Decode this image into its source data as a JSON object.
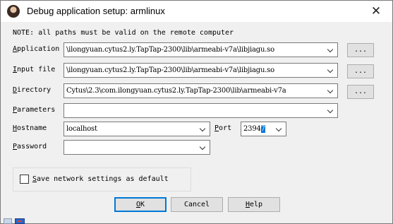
{
  "window": {
    "title": "Debug application setup: armlinux",
    "close_glyph": "✕"
  },
  "note": "NOTE: all paths must be valid on the remote computer",
  "fields": {
    "application": {
      "label": "Application",
      "value": "\\ilongyuan.cytus2.ly.TapTap-2300\\lib\\armeabi-v7a\\libjiagu.so",
      "browse_label": "..."
    },
    "input_file": {
      "label": "Input file",
      "value": "\\ilongyuan.cytus2.ly.TapTap-2300\\lib\\armeabi-v7a\\libjiagu.so",
      "browse_label": "..."
    },
    "directory": {
      "label": "Directory",
      "value": "Cytus\\2.3\\com.ilongyuan.cytus2.ly.TapTap-2300\\lib\\armeabi-v7a",
      "browse_label": "..."
    },
    "parameters": {
      "label": "Parameters",
      "value": ""
    },
    "hostname": {
      "label": "Hostname",
      "value": "localhost"
    },
    "port": {
      "label": "Port",
      "value_plain": "2394",
      "value_selected": "7"
    },
    "password": {
      "label": "Password",
      "value": ""
    }
  },
  "save_settings": {
    "label": "Save network settings as default",
    "checked": false
  },
  "buttons": {
    "ok": "OK",
    "cancel": "Cancel",
    "help": "Help"
  },
  "colors": {
    "accent": "#0078d7",
    "dialog_bg": "#f0f0f0",
    "button_bg": "#e1e1e1"
  },
  "icons": {
    "app": "user-avatar-icon",
    "close": "close-icon",
    "dropdown": "chevron-down-icon"
  }
}
